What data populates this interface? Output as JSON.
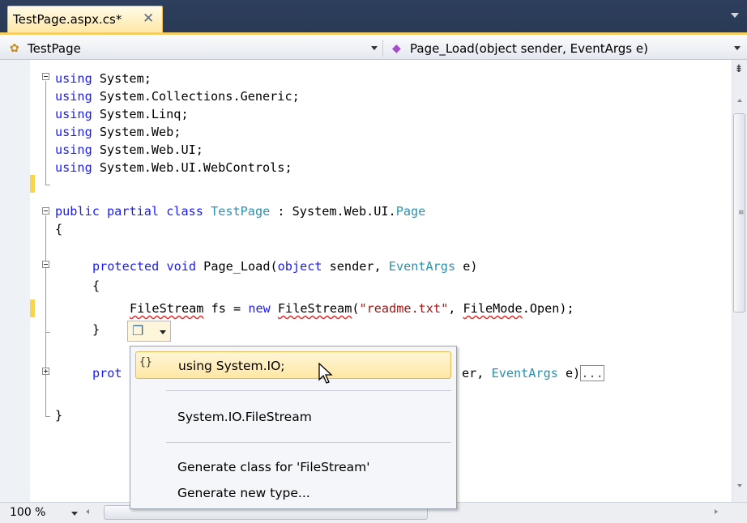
{
  "tab": {
    "title": "TestPage.aspx.cs*",
    "close": "✕"
  },
  "navbar": {
    "class_combo": "TestPage",
    "member_combo": "Page_Load(object sender, EventArgs e)"
  },
  "code": {
    "l1": [
      "using",
      " System;"
    ],
    "l2": [
      "using",
      " System.Collections.Generic;"
    ],
    "l3": [
      "using",
      " System.Linq;"
    ],
    "l4": [
      "using",
      " System.Web;"
    ],
    "l5": [
      "using",
      " System.Web.UI;"
    ],
    "l6": [
      "using",
      " System.Web.UI.WebControls;"
    ],
    "l8": [
      "public",
      " ",
      "partial",
      " ",
      "class",
      " ",
      "TestPage",
      " : System.Web.UI.",
      "Page"
    ],
    "l9": "{",
    "l10": [
      "protected",
      " ",
      "void",
      " Page_Load(",
      "object",
      " sender, ",
      "EventArgs",
      " e)"
    ],
    "l11": "{",
    "l12": [
      "FileStream",
      " fs = ",
      "new",
      " ",
      "FileStream",
      "(",
      "\"readme.txt\"",
      ", ",
      "FileMode",
      ".Open);"
    ],
    "l13": "}",
    "l15a": "prot",
    "l15b": [
      "er, ",
      "EventArgs",
      " e)",
      "..."
    ],
    "l17": "}"
  },
  "smart_tag": {
    "icon": "smart-tag-icon"
  },
  "menu": {
    "items": [
      {
        "label": "using System.IO;",
        "icon": "{}"
      },
      {
        "label": "System.IO.FileStream"
      },
      {
        "label": "Generate class for 'FileStream'"
      },
      {
        "label": "Generate new type..."
      }
    ]
  },
  "zoom": "100 %",
  "colors": {
    "keyword": "#1a1aff",
    "type": "#2b91af",
    "string": "#a31515",
    "change_margin": "#f6d551",
    "tab_bg": "#2b3c59"
  }
}
